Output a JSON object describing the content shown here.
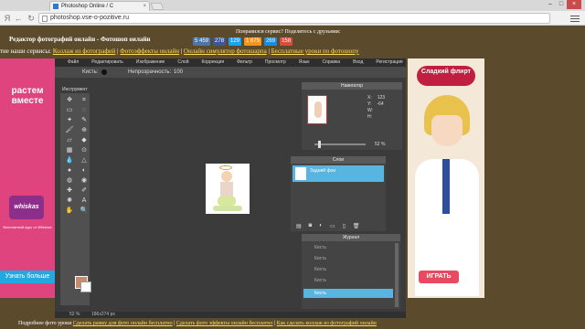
{
  "browser": {
    "tab_title": "Photoshop Online / С",
    "url": "photoshop.vse-o-pozitive.ru",
    "back_icon": "back-arrow-icon",
    "forward_icon": "forward-arrow-icon",
    "reload_icon": "reload-icon",
    "logo_letter": "Я"
  },
  "site": {
    "title": "Редактор фотографий онлайн - Фотошоп онлайн",
    "share_label": "Понравился сервис? Поделитесь с друзьями:",
    "shares": [
      {
        "label": "5 459",
        "color": "#4a76a8"
      },
      {
        "label": "278",
        "color": "#3b5998"
      },
      {
        "label": "129",
        "color": "#1da1f2"
      },
      {
        "label": "1 675",
        "color": "#f7931e"
      },
      {
        "label": "269",
        "color": "#168de2"
      },
      {
        "label": "158",
        "color": "#dd4b39"
      }
    ],
    "services_prefix": "тие наши сервисы: ",
    "services": [
      "Коллаж из фотографий",
      "Фотоэффекты онлайн",
      "Онлайн симулятор фотошарпа",
      "Бесплатные уроки по фотошопу"
    ]
  },
  "ad_left": {
    "slogan": "растем вместе",
    "brand": "whiskas",
    "sub": "Бесплатный курс от Whiskas",
    "button": "Узнать больше"
  },
  "ad_right": {
    "logo": "Сладкий флирт",
    "button": "ИГРАТЬ"
  },
  "editor": {
    "menu": [
      "Файл",
      "Редактировать",
      "Изображение",
      "Слой",
      "Коррекция",
      "Фильтр",
      "Просмотр",
      "Язык",
      "Справка",
      "Вход",
      "Регистрация"
    ],
    "brush_label": "Кисть:",
    "opacity_label": "Непрозрачность:",
    "opacity_value": "100",
    "tools_header": "Инструмент",
    "zoom": "52",
    "zoom_unit": "%",
    "dimensions": "186x274 px",
    "navigator": {
      "title": "Навигатор",
      "x_label": "X:",
      "x_value": "123",
      "y_label": "Y:",
      "y_value": "-64",
      "w_label": "W:",
      "h_label": "H:",
      "zoom": "52",
      "zoom_unit": "%"
    },
    "layers": {
      "title": "Слои",
      "layer_name": "Задний фон"
    },
    "history": {
      "title": "Журнал",
      "items": [
        "Кисть",
        "Кисть",
        "Кисть",
        "Кисть",
        "Кисть"
      ],
      "active": "Кисть"
    }
  },
  "footer": {
    "prefix": "Подробнее фото уроки ",
    "links": [
      "Сделать рамку для фото онлайн бесплатно",
      "Сделать фото эффекты онлайн бесплатно",
      "Как сделать коллаж из фотографий онлайн"
    ]
  }
}
